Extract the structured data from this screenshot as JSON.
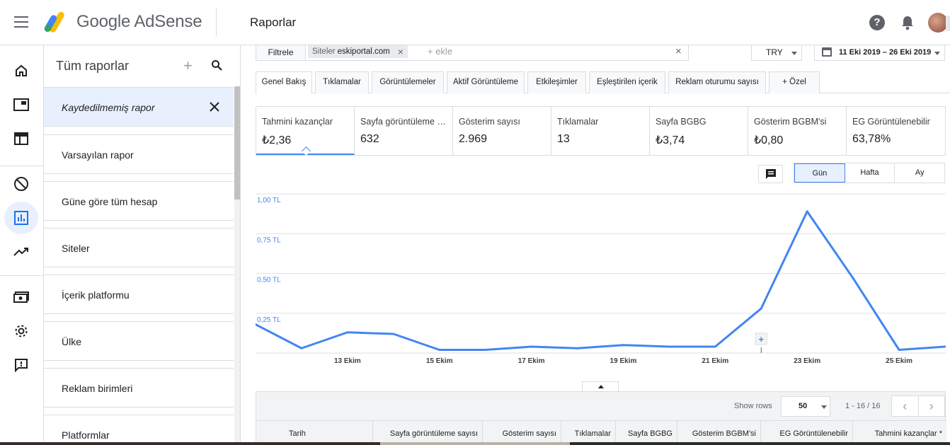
{
  "header": {
    "brand": "Google AdSense",
    "page_title": "Raporlar",
    "help_glyph": "?"
  },
  "rail": {
    "items": [
      {
        "name": "home-icon"
      },
      {
        "name": "ads-icon"
      },
      {
        "name": "sites-icon"
      },
      {
        "name": "blocking-icon"
      },
      {
        "name": "reports-icon",
        "active": true
      },
      {
        "name": "optimization-icon"
      },
      {
        "name": "payments-icon"
      },
      {
        "name": "settings-icon"
      },
      {
        "name": "feedback-icon"
      }
    ]
  },
  "panel": {
    "title": "Tüm raporlar",
    "plus_glyph": "+",
    "current_report": "Kaydedilmemiş rapor",
    "reports": [
      "Varsayılan rapor",
      "Güne göre tüm hesap",
      "Siteler",
      "İçerik platformu",
      "Ülke",
      "Reklam birimleri",
      "Platformlar"
    ]
  },
  "filter": {
    "button": "Filtrele",
    "chip_key": "Siteler",
    "chip_value": "eskiportal.com",
    "chip_close": "×",
    "add_placeholder": "+ ekle",
    "clear_glyph": "×"
  },
  "currency": "TRY",
  "date_range": "11 Eki 2019 – 26 Eki 2019",
  "tabs": [
    "Genel Bakış",
    "Tıklamalar",
    "Görüntülemeler",
    "Aktif Görüntüleme",
    "Etkileşimler",
    "Eşleştirilen içerik",
    "Reklam oturumu sayısı",
    "+  Özel"
  ],
  "metrics": [
    {
      "label": "Tahmini kazançlar",
      "value": "₺2,36",
      "active": true
    },
    {
      "label": "Sayfa görüntüleme sayısı",
      "value": "632"
    },
    {
      "label": "Gösterim sayısı",
      "value": "2.969"
    },
    {
      "label": "Tıklamalar",
      "value": "13"
    },
    {
      "label": "Sayfa BGBG",
      "value": "₺3,74"
    },
    {
      "label": "Gösterim BGBM'si",
      "value": "₺0,80"
    },
    {
      "label": "EG Görüntülenebilir",
      "value": "63,78%"
    }
  ],
  "periods": [
    "Gün",
    "Hafta",
    "Ay"
  ],
  "chart_data": {
    "type": "line",
    "x": [
      "2019-10-11",
      "2019-10-12",
      "2019-10-13",
      "2019-10-14",
      "2019-10-15",
      "2019-10-16",
      "2019-10-17",
      "2019-10-18",
      "2019-10-19",
      "2019-10-20",
      "2019-10-21",
      "2019-10-22",
      "2019-10-23",
      "2019-10-24",
      "2019-10-25",
      "2019-10-26"
    ],
    "series": [
      {
        "values": [
          0.18,
          0.03,
          0.13,
          0.12,
          0.02,
          0.02,
          0.04,
          0.03,
          0.05,
          0.04,
          0.04,
          0.28,
          0.89,
          0.47,
          0.02,
          0.04
        ]
      }
    ],
    "ylim": [
      0,
      0.95
    ],
    "yticks": [
      0.25,
      0.5,
      0.75,
      1.0
    ],
    "ytick_labels": [
      "0,25 TL",
      "0,50 TL",
      "0,75 TL",
      "1,00 TL"
    ],
    "xtick_labels": [
      {
        "x": "2019-10-13",
        "label": "13 Ekim"
      },
      {
        "x": "2019-10-15",
        "label": "15 Ekim"
      },
      {
        "x": "2019-10-17",
        "label": "17 Ekim"
      },
      {
        "x": "2019-10-19",
        "label": "19 Ekim"
      },
      {
        "x": "2019-10-21",
        "label": "21 Ekim"
      },
      {
        "x": "2019-10-23",
        "label": "23 Ekim"
      },
      {
        "x": "2019-10-25",
        "label": "25 Ekim"
      }
    ],
    "annotation_x": "2019-10-22",
    "annotation_glyph": "+",
    "color": "#4285f4",
    "grid": true
  },
  "table": {
    "show_rows_label": "Show rows",
    "rows_value": "50",
    "page_range": "1 - 16 / 16",
    "prev_glyph": "‹",
    "next_glyph": "›",
    "columns": [
      "Tarih",
      "Sayfa görüntüleme sayısı",
      "Gösterim sayısı",
      "Tıklamalar",
      "Sayfa BGBG",
      "Gösterim BGBM'si",
      "EG Görüntülenebilir",
      "Tahmini kazançlar *"
    ]
  },
  "colors": {
    "accent": "#4285f4",
    "active_bg": "#e8f0fe",
    "border": "#dadce0"
  }
}
